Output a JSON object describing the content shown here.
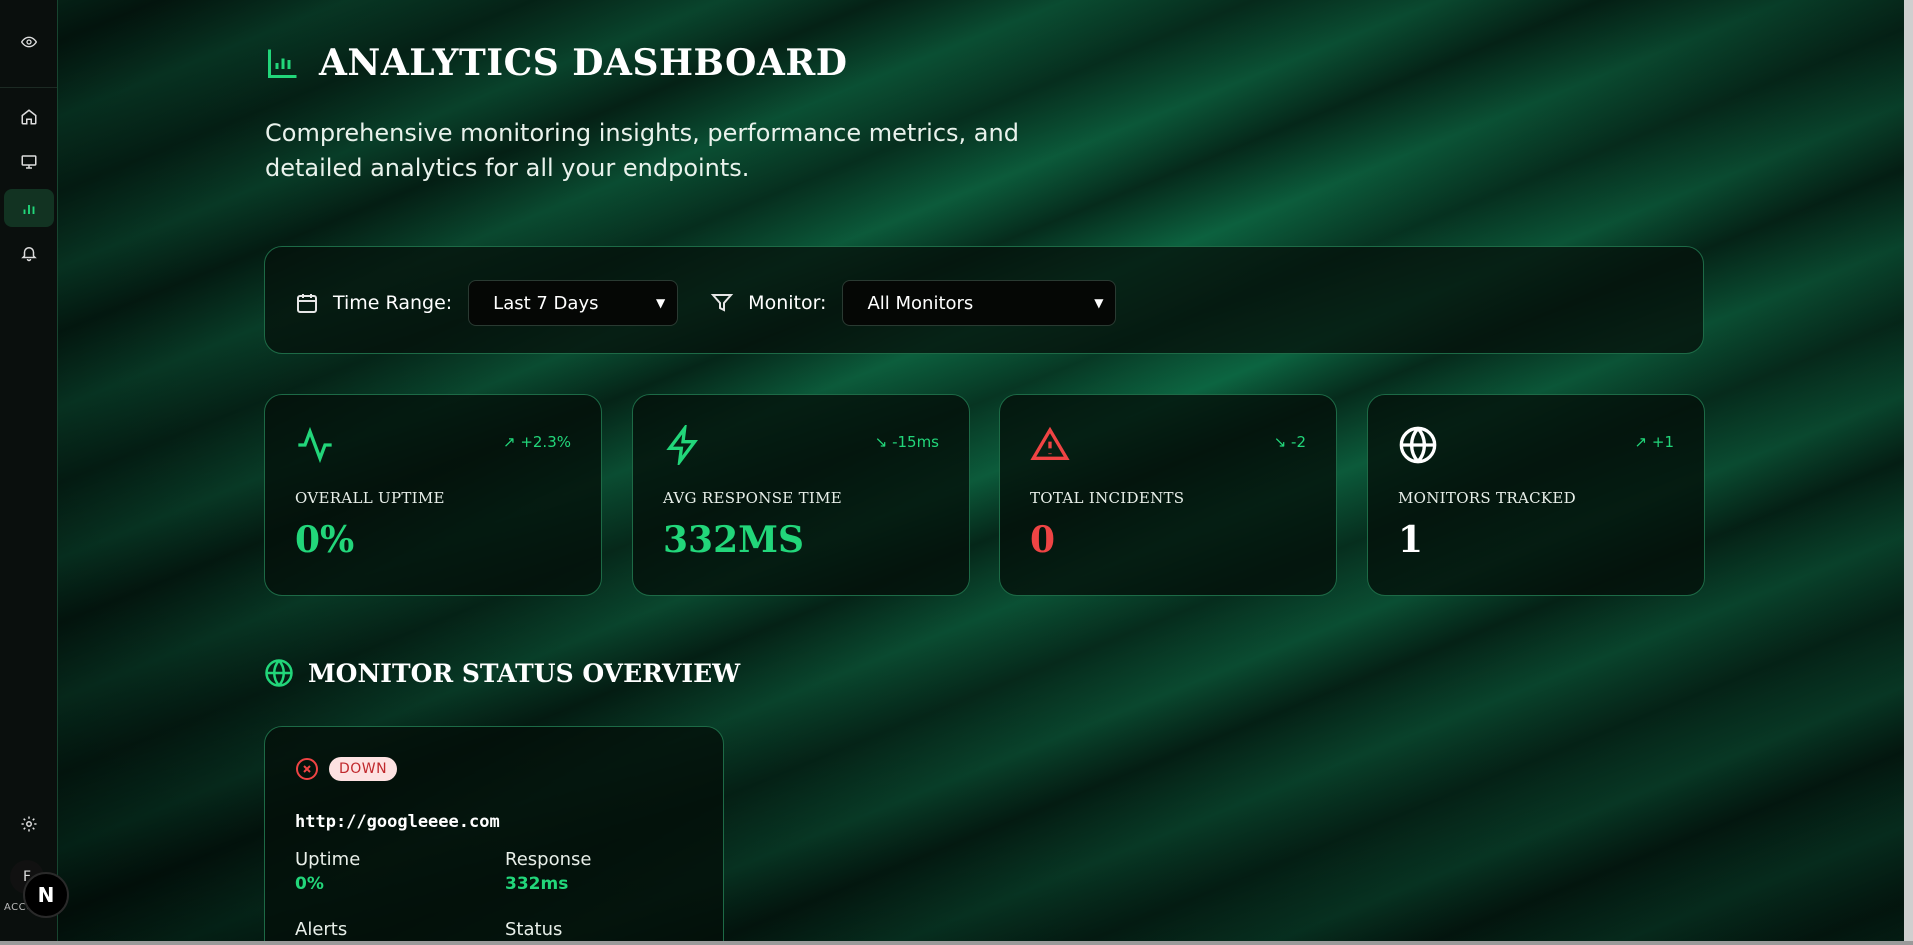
{
  "header": {
    "title": "ANALYTICS DASHBOARD",
    "subtitle": "Comprehensive monitoring insights, performance metrics, and detailed analytics for all your endpoints."
  },
  "filters": {
    "time_range_label": "Time Range:",
    "time_range_value": "Last 7 Days",
    "monitor_label": "Monitor:",
    "monitor_value": "All Monitors"
  },
  "stats": [
    {
      "label": "OVERALL UPTIME",
      "value": "0%",
      "trend": "↗ +2.3%",
      "icon": "activity-icon",
      "value_color": "#22d67a",
      "icon_color": "#22d67a"
    },
    {
      "label": "AVG RESPONSE TIME",
      "value": "332MS",
      "trend": "↘ -15ms",
      "icon": "zap-icon",
      "value_color": "#22d67a",
      "icon_color": "#22d67a"
    },
    {
      "label": "TOTAL INCIDENTS",
      "value": "0",
      "trend": "↘ -2",
      "icon": "alert-triangle-icon",
      "value_color": "#ef4444",
      "icon_color": "#ef4444"
    },
    {
      "label": "MONITORS TRACKED",
      "value": "1",
      "trend": "↗ +1",
      "icon": "globe-icon",
      "value_color": "#ffffff",
      "icon_color": "#ffffff"
    }
  ],
  "section": {
    "title": "MONITOR STATUS OVERVIEW"
  },
  "monitor_card": {
    "status": "DOWN",
    "url": "http://googleeee.com",
    "uptime_label": "Uptime",
    "uptime_value": "0%",
    "response_label": "Response",
    "response_value": "332ms",
    "alerts_label": "Alerts",
    "status_label": "Status"
  },
  "sidebar": {
    "items": [
      "home-icon",
      "monitor-icon",
      "bar-chart-icon",
      "bell-icon"
    ],
    "settings": "gear-icon",
    "account_label": "ACCO",
    "avatar_letter": "F",
    "badge_letter": "N"
  },
  "colors": {
    "accent": "#22d67a",
    "danger": "#ef4444",
    "border": "#1d6a46"
  }
}
